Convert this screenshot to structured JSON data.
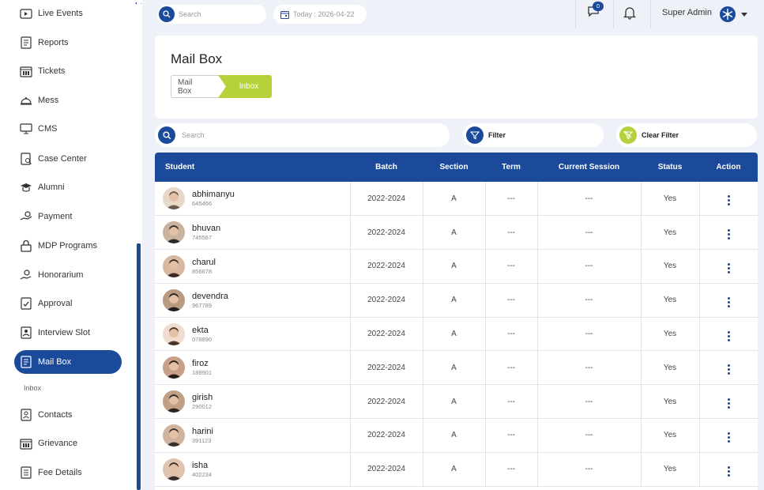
{
  "sidebar": {
    "items": [
      {
        "label": "Live Events",
        "icon": "video-icon"
      },
      {
        "label": "Reports",
        "icon": "report-icon"
      },
      {
        "label": "Tickets",
        "icon": "tickets-icon"
      },
      {
        "label": "Mess",
        "icon": "cloche-icon"
      },
      {
        "label": "CMS",
        "icon": "monitor-icon"
      },
      {
        "label": "Case Center",
        "icon": "case-icon"
      },
      {
        "label": "Alumni",
        "icon": "graduation-icon"
      },
      {
        "label": "Payment",
        "icon": "payment-icon"
      },
      {
        "label": "MDP Programs",
        "icon": "lock-icon"
      },
      {
        "label": "Honorarium",
        "icon": "hand-coin-icon"
      },
      {
        "label": "Approval",
        "icon": "approval-icon"
      },
      {
        "label": "Interview Slot",
        "icon": "interview-icon"
      },
      {
        "label": "Mail Box",
        "icon": "mailbox-icon"
      },
      {
        "label": "Contacts",
        "icon": "contacts-icon"
      },
      {
        "label": "Grievance",
        "icon": "grievance-icon"
      },
      {
        "label": "Fee Details",
        "icon": "fee-icon"
      }
    ],
    "active_sub": "Inbox"
  },
  "topbar": {
    "search_placeholder": "Search",
    "date_text": "Today : 2026-04-22",
    "chat_badge": "0",
    "user_name": "Super Admin"
  },
  "header": {
    "title": "Mail Box",
    "breadcrumb": [
      "Mail Box",
      "Inbox"
    ]
  },
  "filters": {
    "search_placeholder": "Search",
    "filter_label": "Filter",
    "clear_label": "Clear Filter"
  },
  "table": {
    "columns": [
      "Student",
      "Batch",
      "Section",
      "Term",
      "Current Session",
      "Status",
      "Action"
    ],
    "rows": [
      {
        "name": "abhimanyu",
        "id": "645466",
        "batch": "2022-2024",
        "section": "A",
        "term": "---",
        "session": "---",
        "status": "Yes"
      },
      {
        "name": "bhuvan",
        "id": "745567",
        "batch": "2022-2024",
        "section": "A",
        "term": "---",
        "session": "---",
        "status": "Yes"
      },
      {
        "name": "charul",
        "id": "856678",
        "batch": "2022-2024",
        "section": "A",
        "term": "---",
        "session": "---",
        "status": "Yes"
      },
      {
        "name": "devendra",
        "id": "967789",
        "batch": "2022-2024",
        "section": "A",
        "term": "---",
        "session": "---",
        "status": "Yes"
      },
      {
        "name": "ekta",
        "id": "078890",
        "batch": "2022-2024",
        "section": "A",
        "term": "---",
        "session": "---",
        "status": "Yes"
      },
      {
        "name": "firoz",
        "id": "189901",
        "batch": "2022-2024",
        "section": "A",
        "term": "---",
        "session": "---",
        "status": "Yes"
      },
      {
        "name": "girish",
        "id": "290012",
        "batch": "2022-2024",
        "section": "A",
        "term": "---",
        "session": "---",
        "status": "Yes"
      },
      {
        "name": "harini",
        "id": "391123",
        "batch": "2022-2024",
        "section": "A",
        "term": "---",
        "session": "---",
        "status": "Yes"
      },
      {
        "name": "isha",
        "id": "402234",
        "batch": "2022-2024",
        "section": "A",
        "term": "---",
        "session": "---",
        "status": "Yes"
      }
    ]
  },
  "colors": {
    "primary": "#1b4a9a",
    "accent": "#b6d23b",
    "background": "#eef1f7"
  }
}
